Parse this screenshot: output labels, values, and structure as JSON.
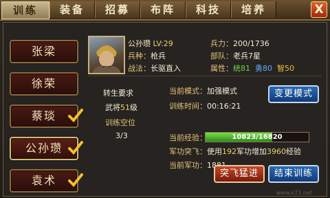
{
  "tabs": [
    {
      "label": "训练",
      "active": true
    },
    {
      "label": "装备",
      "active": false
    },
    {
      "label": "招募",
      "active": false
    },
    {
      "label": "布阵",
      "active": false
    },
    {
      "label": "科技",
      "active": false
    },
    {
      "label": "培养",
      "active": false
    }
  ],
  "close_label": "X",
  "generals": [
    {
      "name": "张梁",
      "checked": false,
      "active": false
    },
    {
      "name": "徐荣",
      "checked": false,
      "active": false
    },
    {
      "name": "蔡琰",
      "checked": true,
      "active": false
    },
    {
      "name": "公孙瓒",
      "checked": true,
      "active": true
    },
    {
      "name": "袁术",
      "checked": true,
      "active": false
    }
  ],
  "hero": {
    "name": "公孙瓒",
    "level": "LV:29",
    "type_label": "兵种：",
    "type_value": "枪兵",
    "tactic_label": "战法：",
    "tactic_value": "长驱直入",
    "troops_label": "兵力：",
    "troops_value": "200/1736",
    "unit_label": "部队：",
    "unit_value": "老兵7星",
    "attr_label": "属性：",
    "attr_lead": "统81",
    "attr_brave": "勇80",
    "attr_wisdom": "智50"
  },
  "rebirth": {
    "title": "转生要求",
    "req_prefix": "武将",
    "req_level": "51",
    "req_suffix": "级",
    "slots_title": "训练空位",
    "slots_value": "3/3"
  },
  "training": {
    "mode_label": "当前模式：",
    "mode_value": "加强模式",
    "time_label": "训练时间：",
    "time_value": "00:16:21",
    "exp_label": "当前经验：",
    "exp_text": "10823/16820",
    "exp_fraction": 0.6435,
    "merit_break_label": "军功突飞：",
    "merit_break_prefix": "使用",
    "merit_break_amount": "192",
    "merit_break_mid": "军功增加",
    "merit_break_exp": "3960",
    "merit_break_suffix": "经验",
    "merit_label": "当前军功：",
    "merit_value": "1881"
  },
  "buttons": {
    "change_mode": "变更模式",
    "breakthrough": "突飞猛进",
    "end_training": "结束训练"
  },
  "watermark": "www.k73.net",
  "colors": {
    "accent_gold": "#e8c27a",
    "green": "#6fd44a",
    "blue": "#6aa8ff",
    "yellow": "#e6c040"
  }
}
